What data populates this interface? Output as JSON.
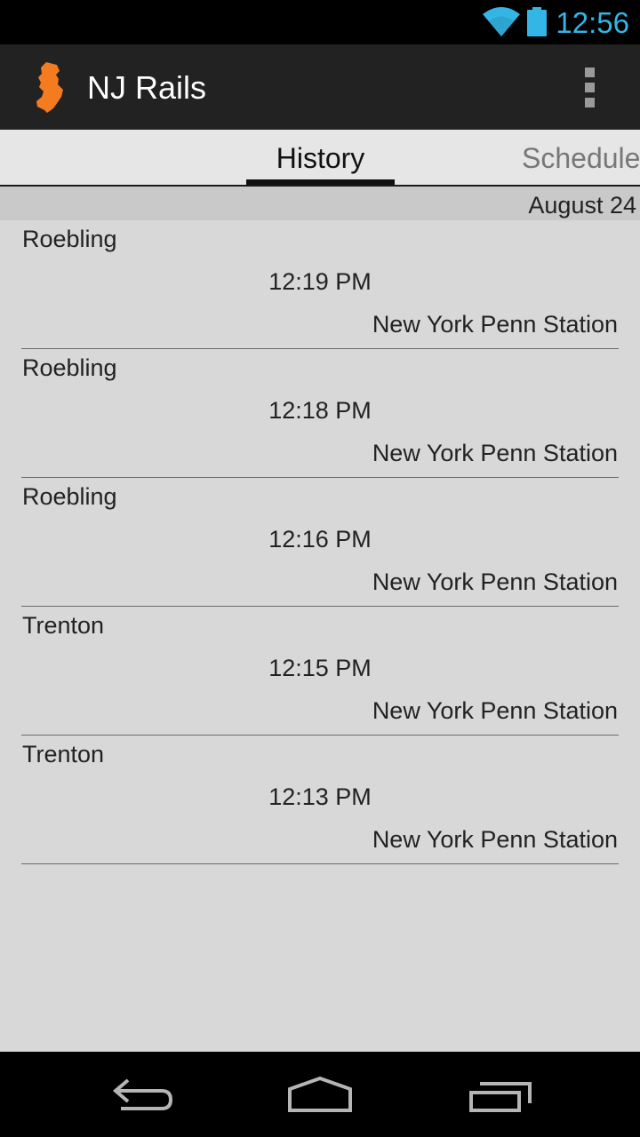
{
  "status_bar": {
    "time": "12:56",
    "icons": [
      "wifi-icon",
      "battery-icon"
    ],
    "accent_color": "#33b5e5"
  },
  "action_bar": {
    "app_icon": "new-jersey-icon",
    "app_icon_color": "#f47b20",
    "title": "NJ Rails",
    "overflow_icon": "overflow-menu-icon"
  },
  "tabs": [
    {
      "label": "History",
      "active": true
    },
    {
      "label": "Schedule",
      "active": false
    }
  ],
  "date_header": "August 24",
  "history": [
    {
      "origin": "Roebling",
      "time": "12:19 PM",
      "destination": "New York Penn Station"
    },
    {
      "origin": "Roebling",
      "time": "12:18 PM",
      "destination": "New York Penn Station"
    },
    {
      "origin": "Roebling",
      "time": "12:16 PM",
      "destination": "New York Penn Station"
    },
    {
      "origin": "Trenton",
      "time": "12:15 PM",
      "destination": "New York Penn Station"
    },
    {
      "origin": "Trenton",
      "time": "12:13 PM",
      "destination": "New York Penn Station"
    }
  ],
  "nav_bar": {
    "icons": [
      "back-icon",
      "home-icon",
      "recents-icon"
    ]
  }
}
